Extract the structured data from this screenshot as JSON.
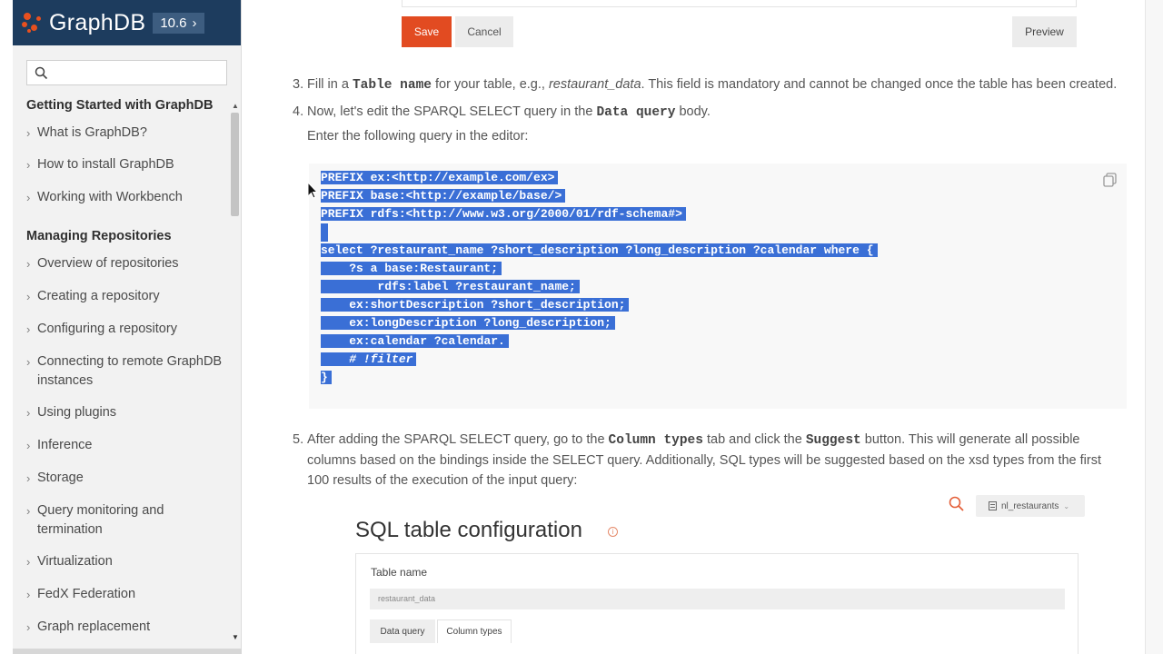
{
  "sidebar": {
    "brand": "GraphDB",
    "version": "10.6",
    "search_placeholder": "",
    "sections": [
      {
        "title": "Getting Started with GraphDB",
        "items": [
          "What is GraphDB?",
          "How to install GraphDB",
          "Working with Workbench"
        ]
      },
      {
        "title": "Managing Repositories",
        "items": [
          "Overview of repositories",
          "Creating a repository",
          "Configuring a repository",
          "Connecting to remote GraphDB instances",
          "Using plugins",
          "Inference",
          "Storage",
          "Query monitoring and termination",
          "Virtualization",
          "FedX Federation",
          "Graph replacement"
        ]
      }
    ]
  },
  "toolbar": {
    "save": "Save",
    "cancel": "Cancel",
    "preview": "Preview"
  },
  "steps": {
    "s3": {
      "num": "3.",
      "t1": "Fill in a",
      "code1": "Table name",
      "t2": "for your table, e.g.,",
      "example": "restaurant_data",
      "t3": ". This field is mandatory and cannot be changed once the table has been created."
    },
    "s4": {
      "num": "4.",
      "t1": "Now, let's edit the SPARQL SELECT query in the",
      "code1": "Data query",
      "t2": "body."
    },
    "enter": "Enter the following query in the editor:",
    "s5": {
      "num": "5.",
      "t1": "After adding the SPARQL SELECT query, go to the",
      "code1": "Column types",
      "t2": "tab and click the",
      "code2": "Suggest",
      "t3": "button. This will generate all possible",
      "line2": "columns based on the bindings inside the SELECT query. Additionally, SQL types will be suggested based on the xsd types from the first",
      "line3": "100 results of the execution of the input query:"
    }
  },
  "code": {
    "lines": [
      "PREFIX ex:<http://example.com/ex>",
      "PREFIX base:<http://example/base/>",
      "PREFIX rdfs:<http://www.w3.org/2000/01/rdf-schema#>",
      "",
      "select ?restaurant_name ?short_description ?long_description ?calendar where {",
      "    ?s a base:Restaurant;",
      "        rdfs:label ?restaurant_name;",
      "    ex:shortDescription ?short_description;",
      "    ex:longDescription ?long_description;",
      "    ex:calendar ?calendar.",
      "    # !filter",
      "}"
    ]
  },
  "screenshot": {
    "repo": "nl_restaurants",
    "title": "SQL table configuration",
    "table_name_label": "Table name",
    "table_name_value": "restaurant_data",
    "tab_data_query": "Data query",
    "tab_column_types": "Column types"
  },
  "colors": {
    "brand_bg": "#1d3c5e",
    "save_bg": "#e24b21",
    "selection": "#3a6fd6"
  }
}
